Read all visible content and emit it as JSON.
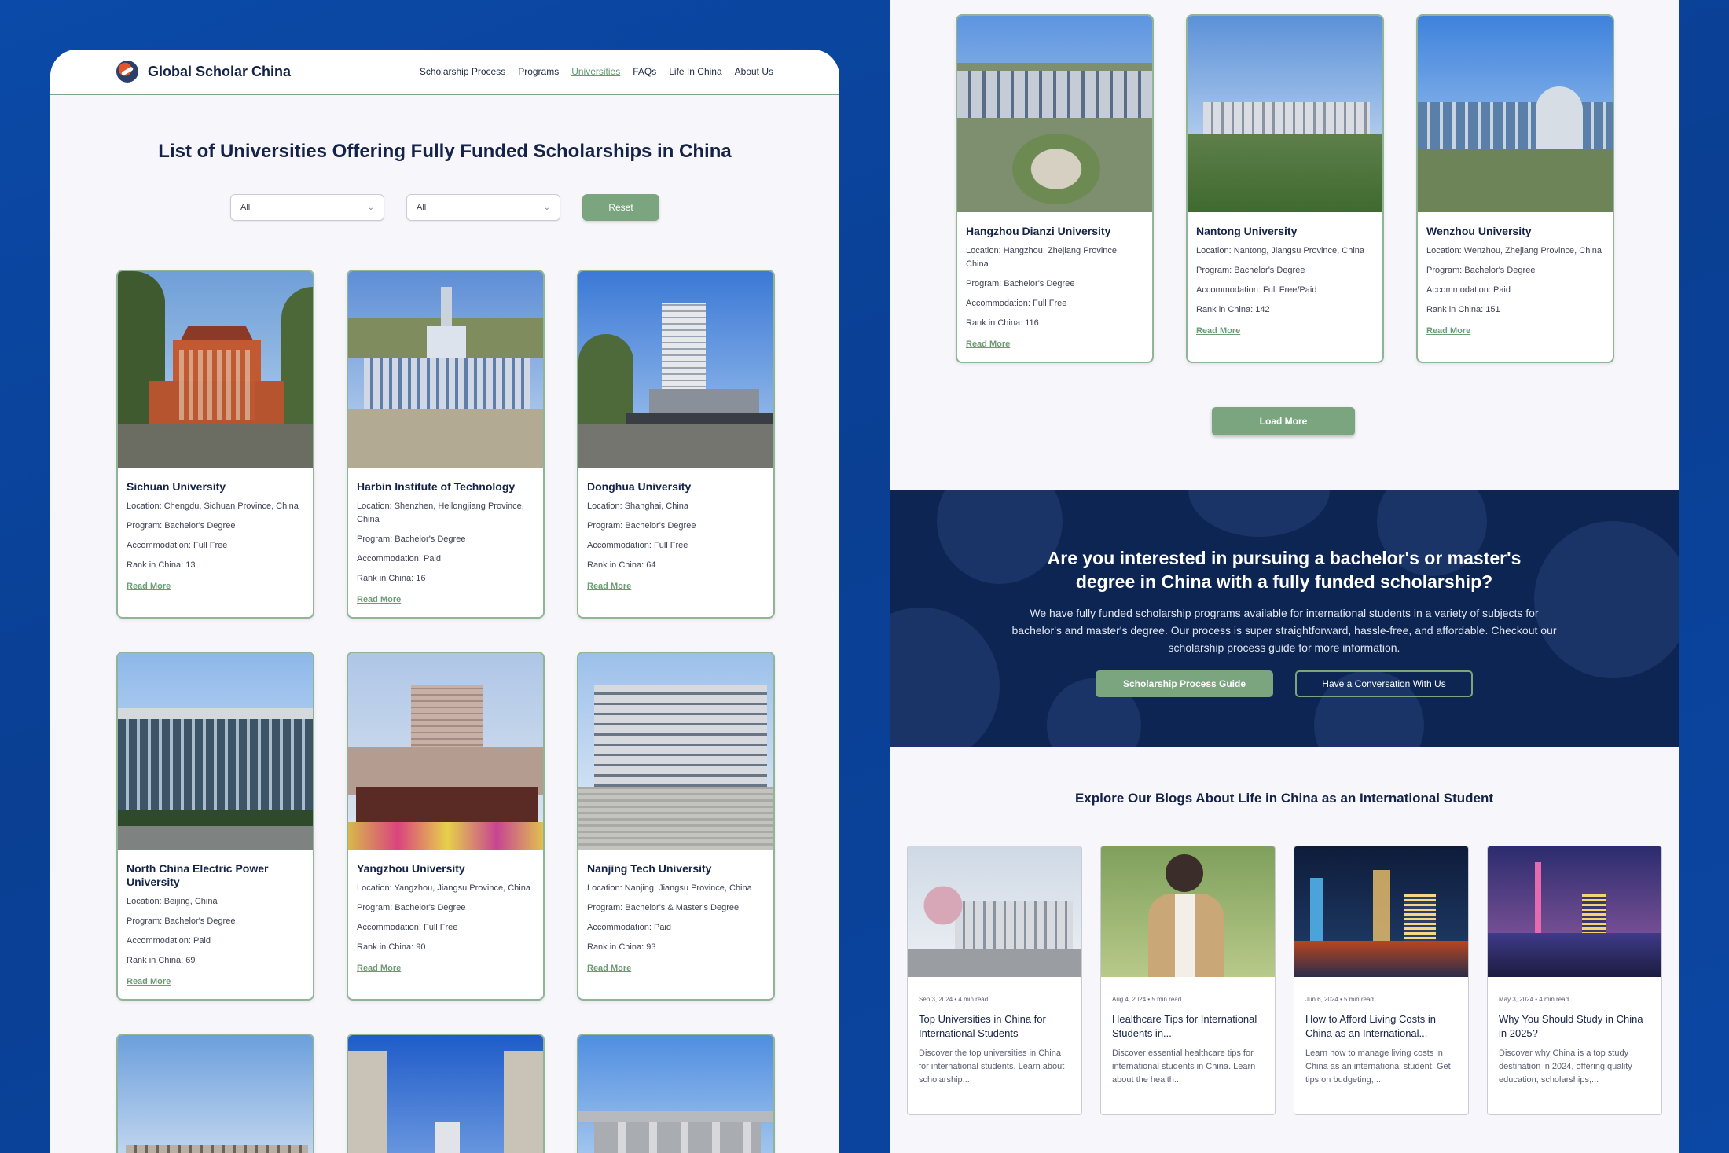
{
  "header": {
    "brand": "Global Scholar China",
    "nav": [
      "Scholarship Process",
      "Programs",
      "Universities",
      "FAQs",
      "Life In China",
      "About Us"
    ],
    "active_nav": "Universities"
  },
  "page_title": "List of Universities Offering Fully Funded Scholarships in China",
  "filters": {
    "select1": "All",
    "select2": "All",
    "reset": "Reset"
  },
  "read_more": "Read More",
  "universities": [
    {
      "name": "Sichuan University",
      "location": "Location: Chengdu, Sichuan Province, China",
      "program": "Program: Bachelor's Degree",
      "accommodation": "Accommodation: Full Free",
      "rank": "Rank in China: 13"
    },
    {
      "name": "Harbin Institute of Technology",
      "location": "Location: Shenzhen, Heilongjiang Province, China",
      "program": "Program: Bachelor's Degree",
      "accommodation": "Accommodation: Paid",
      "rank": "Rank in China: 16"
    },
    {
      "name": "Donghua University",
      "location": "Location: Shanghai, China",
      "program": "Program: Bachelor's Degree",
      "accommodation": "Accommodation: Full Free",
      "rank": "Rank in China: 64"
    },
    {
      "name": "North China Electric Power University",
      "location": "Location: Beijing, China",
      "program": "Program: Bachelor's Degree",
      "accommodation": "Accommodation: Paid",
      "rank": "Rank in China: 69"
    },
    {
      "name": "Yangzhou University",
      "location": "Location: Yangzhou, Jiangsu Province, China",
      "program": "Program: Bachelor's Degree",
      "accommodation": "Accommodation: Full Free",
      "rank": "Rank in China: 90"
    },
    {
      "name": "Nanjing Tech University",
      "location": "Location: Nanjing, Jiangsu Province, China",
      "program": "Program: Bachelor's & Master's Degree",
      "accommodation": "Accommodation: Paid",
      "rank": "Rank in China: 93"
    }
  ],
  "universities_more": [
    {
      "name": "Hangzhou Dianzi University",
      "location": "Location: Hangzhou, Zhejiang Province, China",
      "program": "Program: Bachelor's Degree",
      "accommodation": "Accommodation: Full Free",
      "rank": "Rank in China: 116"
    },
    {
      "name": "Nantong University",
      "location": "Location: Nantong, Jiangsu Province, China",
      "program": "Program: Bachelor's Degree",
      "accommodation": "Accommodation: Full Free/Paid",
      "rank": "Rank in China: 142"
    },
    {
      "name": "Wenzhou University",
      "location": "Location: Wenzhou, Zhejiang Province, China",
      "program": "Program: Bachelor's Degree",
      "accommodation": "Accommodation: Paid",
      "rank": "Rank in China: 151"
    }
  ],
  "load_more": "Load More",
  "cta": {
    "title": "Are you interested in pursuing a bachelor's or master's degree in China with a fully funded scholarship?",
    "text": "We have fully funded scholarship programs available for international students in a variety of subjects for bachelor's and master's degree. Our process is super straightforward, hassle-free, and affordable. Checkout our scholarship process guide for more information.",
    "guide_button": "Scholarship Process Guide",
    "conversation_button": "Have a Conversation With Us"
  },
  "blogs_title": "Explore Our Blogs About Life in China as an International Student",
  "blogs": [
    {
      "meta": "Sep 3, 2024  •  4 min read",
      "title": "Top Universities in China for International Students",
      "excerpt": "Discover the top universities in China for international students. Learn about scholarship..."
    },
    {
      "meta": "Aug 4, 2024  •  5 min read",
      "title": "Healthcare Tips for International Students in...",
      "excerpt": "Discover essential healthcare tips for international students in China. Learn about the health..."
    },
    {
      "meta": "Jun 6, 2024  •  5 min read",
      "title": "How to Afford Living Costs in China as an International...",
      "excerpt": "Learn how to manage living costs in China as an international student. Get tips on budgeting,..."
    },
    {
      "meta": "May 3, 2024  •  4 min read",
      "title": "Why You Should Study in China in 2025?",
      "excerpt": "Discover why China is a top study destination in 2024, offering quality education, scholarships,..."
    }
  ]
}
